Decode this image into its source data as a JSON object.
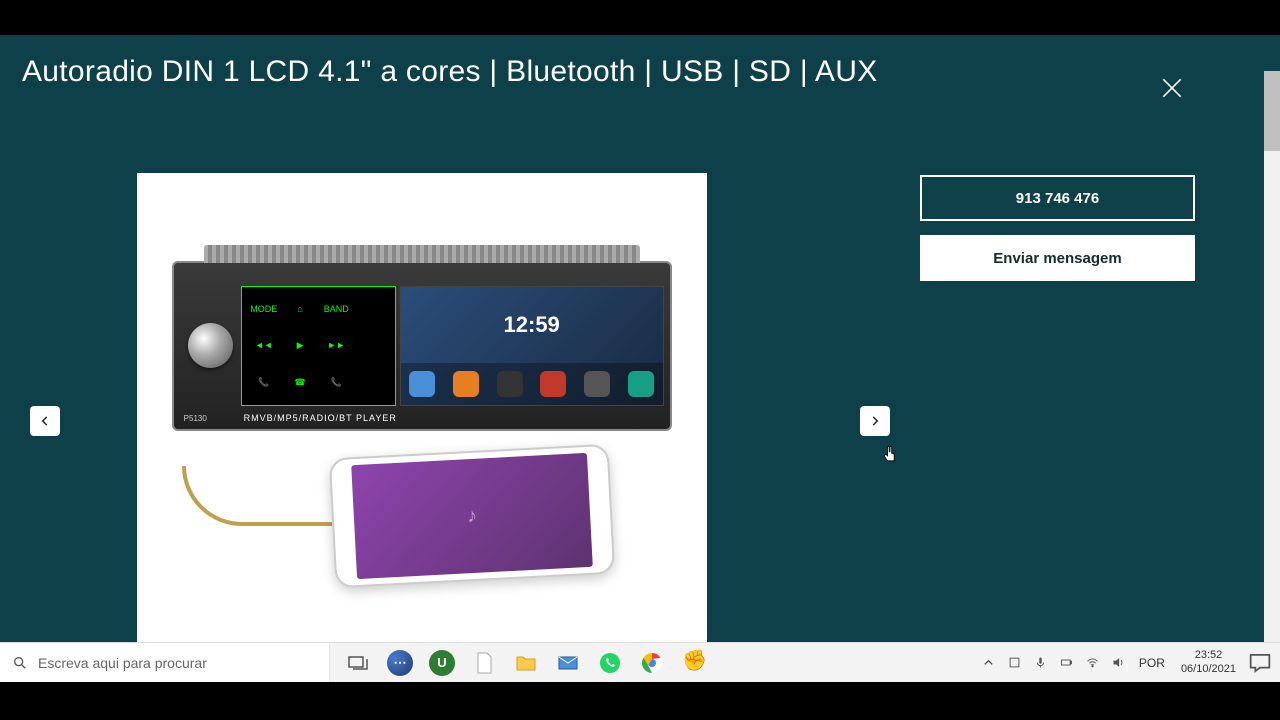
{
  "page": {
    "title": "Autoradio DIN 1 LCD 4.1\" a cores | Bluetooth | USB | SD | AUX"
  },
  "product": {
    "screen_time": "12:59",
    "player_label": "RMVB/MP5/RADIO/BT PLAYER",
    "model": "P5130",
    "left_btns": [
      "MODE",
      "⌂",
      "BAND",
      "◄◄",
      "▶",
      "►►",
      "📞",
      "☎",
      "📞"
    ]
  },
  "cta": {
    "phone": "913 746 476",
    "message": "Enviar mensagem"
  },
  "taskbar": {
    "search_placeholder": "Escreva aqui para procurar",
    "language": "POR",
    "time": "23:52",
    "date": "06/10/2021"
  }
}
